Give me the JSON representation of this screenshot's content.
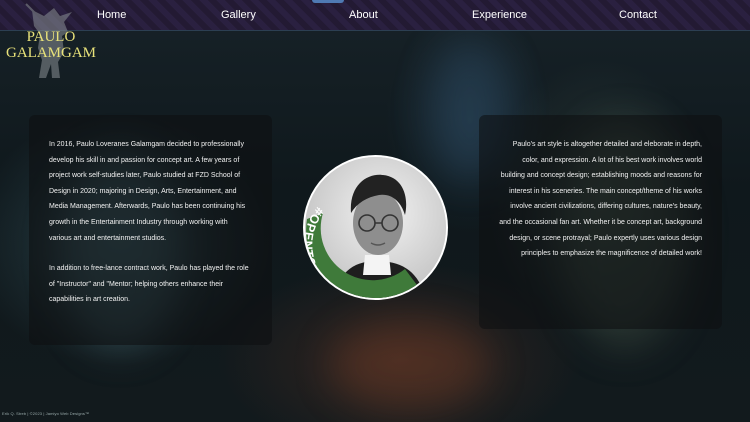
{
  "nav": {
    "items": [
      "Home",
      "Gallery",
      "About",
      "Experience",
      "Contact"
    ]
  },
  "logo": {
    "line1": "PAULO",
    "line2": "GALAMGAM"
  },
  "about": {
    "left_p1": "In 2016, Paulo Loveranes Galamgam decided to professionally develop his skill in and passion for concept art. A few years of project work self-studies later, Paulo studied at FZD School of Design in 2020; majoring in Design, Arts, Entertainment, and Media Management. Afterwards, Paulo has been continuing his growth in the Entertainment Industry through working with various art and entertainment studios.",
    "left_p2": "In addition to free-lance contract work, Paulo has played the role of \"Instructor\" and \"Mentor; helping others enhance their capabilities in art creation.",
    "right_p1": "Paulo's art style is altogether detailed and eleborate in depth, color, and expression. A lot of his best work involves world building and concept design; establishing moods and reasons for interest in his sceneries. The main concept/theme of his works involve ancient civilizations, differing cultures, nature's beauty, and the occasional fan art. Whether it be concept art, background design, or scene protrayal; Paulo expertly uses various design principles to emphasize the magnificence of detailed work!"
  },
  "portrait": {
    "badge": "#OPENTOWORK",
    "badge_color": "#3f7a3a"
  },
  "footer": {
    "text": "Erik Q. Streb | ©2023 | Jamiyo Web Designs™"
  }
}
